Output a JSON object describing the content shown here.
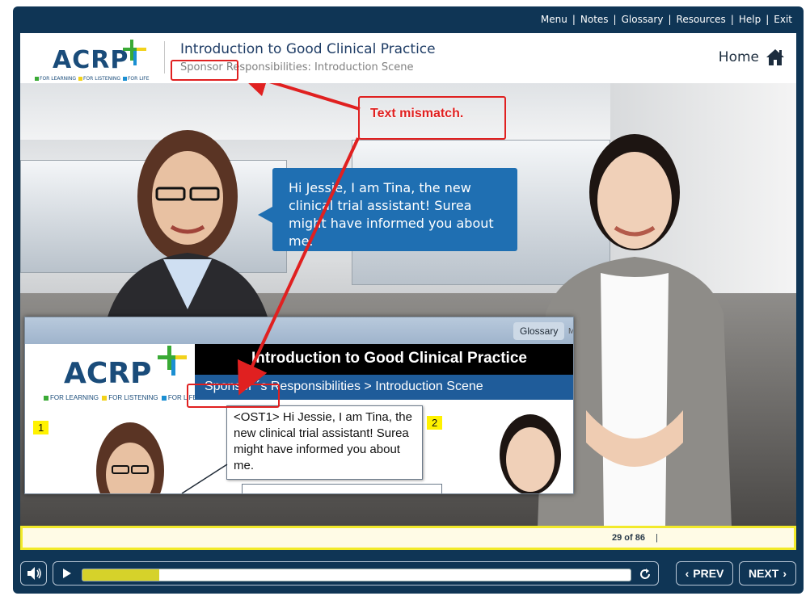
{
  "topnav": {
    "items": [
      "Menu",
      "Notes",
      "Glossary",
      "Resources",
      "Help",
      "Exit"
    ]
  },
  "header": {
    "logo": {
      "text": "ACRP",
      "tagline": [
        "FOR LEARNING",
        "FOR LISTENING",
        "FOR LIFE"
      ]
    },
    "course_title": "Introduction to Good Clinical Practice",
    "scene_title": "Sponsor Responsibilities: Introduction Scene",
    "home_label": "Home"
  },
  "stage": {
    "speech": "Hi Jessie, I am Tina, the new clinical trial assistant! Surea might have informed you about me.",
    "annotation": "Text mismatch.",
    "inset": {
      "glossary": "Glossary",
      "m_label": "M",
      "logo_text": "ACRP",
      "logo_tagline": [
        "FOR LEARNING",
        "FOR LISTENING",
        "FOR LIFE"
      ],
      "title": "Introduction to Good Clinical Practice",
      "subtitle": "Sponsor ´s Responsibilities > Introduction Scene",
      "callout": "<OST1> Hi Jessie, I am Tina, the new clinical trial assistant! Surea might have informed you about me.",
      "marker1": "1",
      "marker2": "2"
    }
  },
  "footer": {
    "page_count": "29 of 86",
    "separator": "|"
  },
  "controls": {
    "prev_label": "PREV",
    "next_label": "NEXT",
    "progress_fraction": 0.14
  },
  "colors": {
    "frame": "#0f3555",
    "accent_blue": "#1f6fb2",
    "annotation_red": "#e02020",
    "progress_yellow": "#d6d22a",
    "logo_green": "#3aaa35",
    "logo_yellow": "#f2d21b",
    "logo_blue": "#1b8fd2"
  }
}
